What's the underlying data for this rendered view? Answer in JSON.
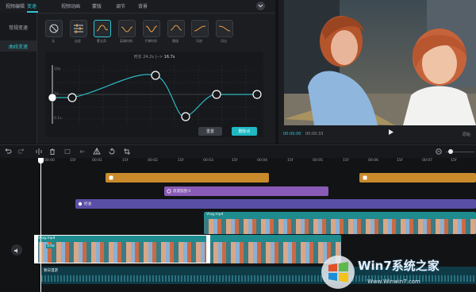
{
  "tabs": [
    {
      "label": "视频编辑",
      "active": false
    },
    {
      "label": "变速",
      "active": true
    },
    {
      "label": "视频动画",
      "active": false
    },
    {
      "label": "蒙版",
      "active": false
    },
    {
      "label": "调节",
      "active": false
    },
    {
      "label": "背景",
      "active": false
    }
  ],
  "sidebar": {
    "items": [
      {
        "label": "常规变速",
        "active": false
      },
      {
        "label": "曲线变速",
        "active": true
      }
    ]
  },
  "presets": [
    {
      "label": "无",
      "icon": "no-icon"
    },
    {
      "label": "自定",
      "icon": "custom-icon"
    },
    {
      "label": "蒙太奇",
      "icon": "curve-icon"
    },
    {
      "label": "英雄时刻",
      "icon": "curve-icon"
    },
    {
      "label": "子弹时间",
      "icon": "curve-icon"
    },
    {
      "label": "跳接",
      "icon": "curve-icon"
    },
    {
      "label": "闪进",
      "icon": "curve-icon"
    },
    {
      "label": "闪出",
      "icon": "curve-icon"
    }
  ],
  "speed_editor": {
    "duration_prefix": "时长",
    "duration_from": "24.2s",
    "arrow": "|-->",
    "duration_to": "16.7s",
    "y_top": "10x",
    "y_mid": "1x",
    "y_bottom": "0.1x",
    "reset_label": "重置",
    "delete_label": "删除点"
  },
  "preview": {
    "timecode_current": "00:00:00",
    "timecode_total": "00:00:33",
    "play_icon": "play-icon",
    "ratio_label": "原始"
  },
  "toolbar_icons": [
    "undo-icon",
    "redo-icon",
    "split-icon",
    "delete-icon",
    "freeze-icon",
    "reverse-icon",
    "mirror-icon",
    "rotate-icon",
    "crop-icon"
  ],
  "ruler_labels": [
    "00:00",
    "15f",
    "00:01",
    "15f",
    "00:02",
    "15f",
    "00:03",
    "15f",
    "00:04",
    "15f",
    "00:05",
    "15f",
    "00:06",
    "15f",
    "00:07",
    "15f"
  ],
  "clips": {
    "sticker1_icon": "sticker-icon",
    "sticker2_icon": "sticker-icon",
    "effect_label": "浪漫氛围 II",
    "filter_label": "奶油",
    "video1_label": "Vlog.mp4",
    "video2_label": "Vlog.mp4",
    "video2_speed": "3.0x",
    "audio_label": "春日漫游"
  },
  "watermark": {
    "brand": "Win7系统之家",
    "url": "Www.Winwin7.com"
  },
  "colors": {
    "accent": "#30c4cf",
    "sticker": "#c88a2a",
    "effect": "#8a5bb6",
    "filter": "#5a4fa6",
    "video": "#1e8b8e",
    "audio": "#0f3b47"
  }
}
